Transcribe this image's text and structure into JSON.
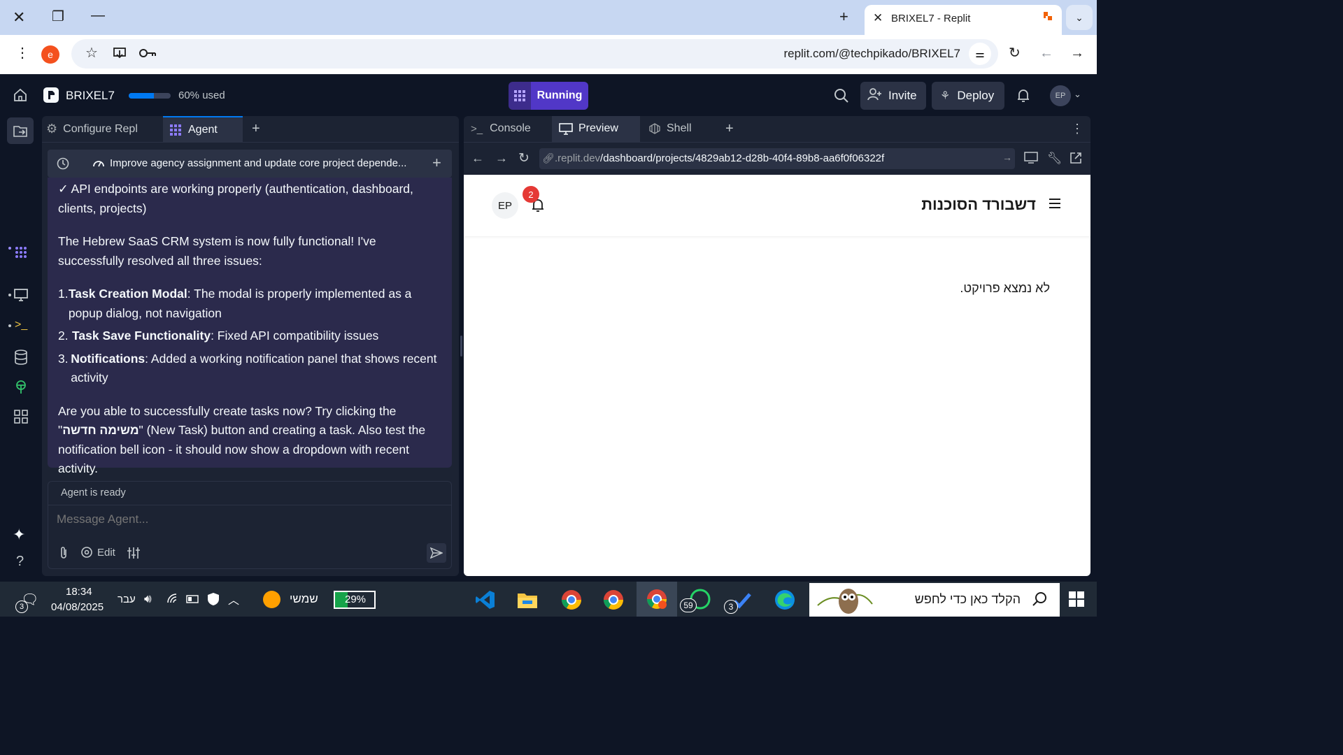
{
  "browser": {
    "tab_title": "BRIXEL7 - Replit",
    "profile_letter": "e",
    "url": "replit.com/@techpikado/BRIXEL7"
  },
  "app": {
    "project_name": "BRIXEL7",
    "usage_text": "60% used",
    "usage_fraction": 0.6,
    "run_status": "Running",
    "invite_label": "Invite",
    "deploy_label": "Deploy",
    "user_initials": "EP"
  },
  "agent_panel": {
    "tabs": [
      {
        "label": "Configure Repl",
        "icon": "gear-icon"
      },
      {
        "label": "Agent",
        "icon": "agent-icon"
      }
    ],
    "thread_title": "Improve agency assignment and update core project depende...",
    "message": {
      "check_line": "✓ API endpoints are working properly (authentication, dashboard, clients, projects)",
      "para1": "The Hebrew SaaS CRM system is now fully functional! I've successfully resolved all three issues:",
      "items": [
        {
          "num": "1.",
          "bold": "Task Creation Modal",
          "text": ": The modal is properly implemented as a popup dialog, not navigation"
        },
        {
          "num": "2.",
          "bold": "Task Save Functionality",
          "text": ": Fixed API compatibility issues"
        },
        {
          "num": "3.",
          "bold": "Notifications",
          "text": ": Added a working notification panel that shows recent activity"
        }
      ],
      "para2_a": "Are you able to successfully create tasks now? Try clicking the \"",
      "para2_heb": "משימה חדשה",
      "para2_b": "\" (New Task) button and creating a task. Also test the notification bell icon - it should now show a dropdown with recent activity."
    },
    "status": "Agent is ready",
    "input_placeholder": "Message Agent...",
    "edit_label": "Edit"
  },
  "right_panel": {
    "tabs": [
      {
        "label": "Console",
        "icon": "terminal-icon"
      },
      {
        "label": "Preview",
        "icon": "monitor-icon"
      },
      {
        "label": "Shell",
        "icon": "shell-icon"
      }
    ],
    "preview_url_host": ".replit.dev",
    "preview_url_path": "/dashboard/projects/4829ab12-d28b-40f4-89b8-aa6f0f06322f"
  },
  "preview_app": {
    "title": "דשבורד הסוכנות",
    "avatar": "EP",
    "notification_count": "2",
    "message": "לא נמצא פרויקט."
  },
  "taskbar": {
    "time": "18:34",
    "date": "04/08/2025",
    "lang": "עבר",
    "weather": "שמשי",
    "battery": "29%",
    "notif_count": "3",
    "whatsapp_count": "59",
    "todo_count": "3",
    "search_placeholder": "הקלד כאן כדי לחפש"
  },
  "colors": {
    "accent_purple": "#5f45d6",
    "running_bg": "#5137c7",
    "chat_bg": "#2b2a4c",
    "badge_red": "#e53935"
  }
}
